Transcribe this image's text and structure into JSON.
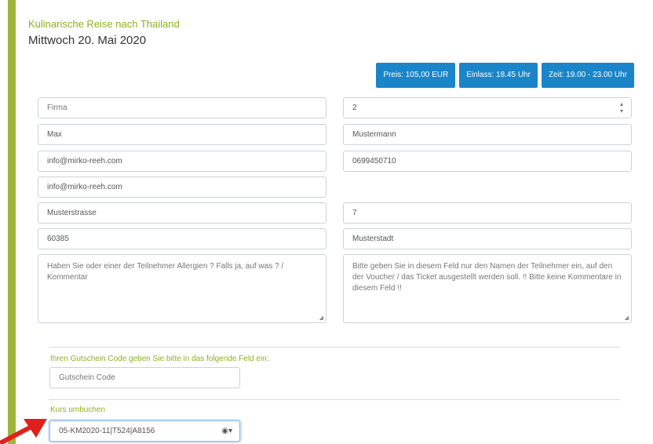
{
  "event": {
    "title": "Kulinarische Reise nach Thailand",
    "date": "Mittwoch 20. Mai 2020"
  },
  "badges": {
    "price": "Preis: 105,00 EUR",
    "entry": "Einlass: 18.45 Uhr",
    "time": "Zeit: 19.00 - 23.00 Uhr"
  },
  "form": {
    "company_placeholder": "Firma",
    "participants_value": "2",
    "first_name": "Max",
    "last_name": "Mustermann",
    "email": "info@mirko-reeh.com",
    "phone": "0699450710",
    "email_confirm": "info@mirko-reeh.com",
    "street": "Musterstrasse",
    "house_number": "7",
    "zip": "60385",
    "city": "Musterstadt",
    "allergies_placeholder": "Haben Sie oder einer der Teilnehmer Allergien ? Falls ja, auf was ? / Kommentar",
    "voucher_names_placeholder": "Bitte geben Sie in diesem Feld nur den Namen der Teilnehmer ein, auf den der Voucher / das Ticket ausgestellt werden soll. !! Bitte keine Kommentare in diesem Feld !!"
  },
  "voucher": {
    "label": "Ihren Gutschein Code geben Sie bitte in das folgende Feld ein:",
    "placeholder": "Gutschein Code"
  },
  "rebook": {
    "label": "Kurs umbuchen",
    "selected": "05-KM2020-11|T524|A8156"
  },
  "colors": {
    "accent_green": "#8ab31f",
    "badge_blue": "#1a85c8",
    "arrow_red": "#e0201c"
  }
}
